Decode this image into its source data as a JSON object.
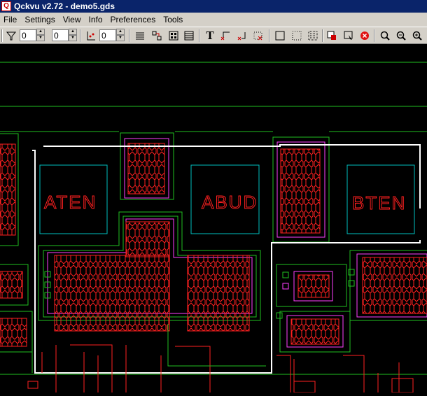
{
  "window": {
    "title": "Qckvu v2.72 - demo5.gds"
  },
  "menu": [
    "File",
    "Settings",
    "View",
    "Info",
    "Preferences",
    "Tools"
  ],
  "toolbar": {
    "filter_value": "0",
    "second_value": "0",
    "level_value": "0"
  },
  "layout": {
    "labels": [
      "ATEN",
      "ABUD",
      "BTEN"
    ]
  },
  "colors": {
    "titlebar": "#0a246a",
    "chrome": "#d4d0c8",
    "canvas": "#000000",
    "poly": "#ff2020",
    "metal": "#20c020",
    "boundary": "#ffffff",
    "via": "#00c0c0",
    "implant": "#ff40ff"
  }
}
